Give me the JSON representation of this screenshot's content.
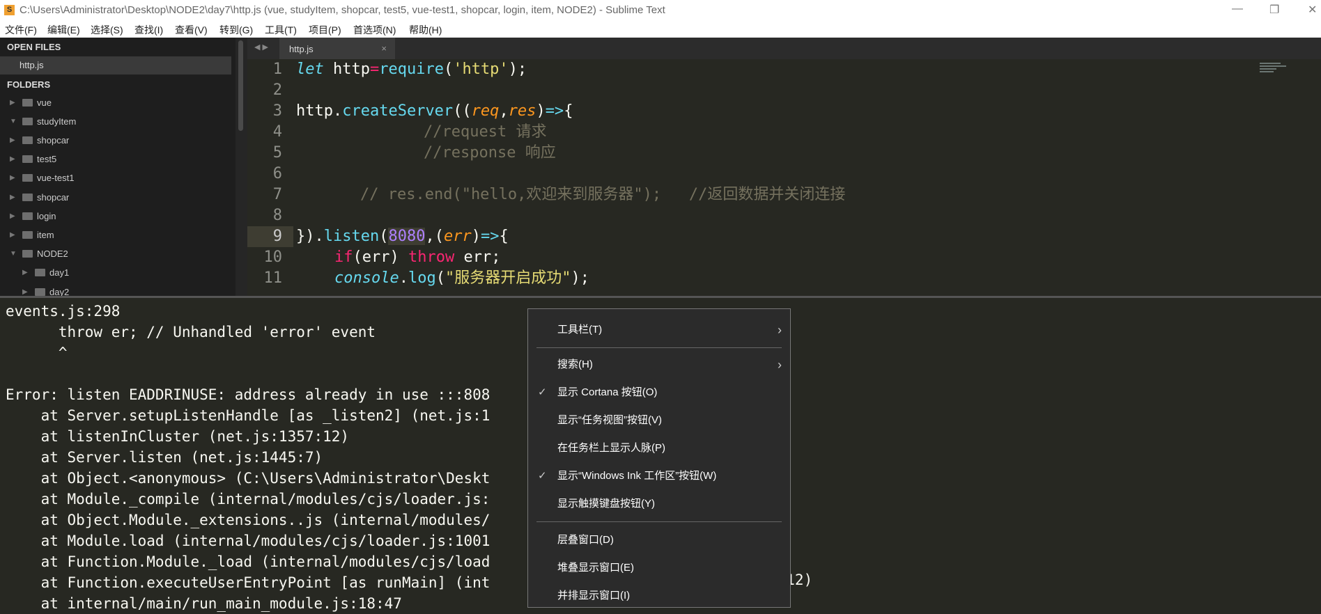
{
  "window": {
    "title": "C:\\Users\\Administrator\\Desktop\\NODE2\\day7\\http.js (vue, studyItem, shopcar, test5, vue-test1, shopcar, login, item, NODE2) - Sublime Text",
    "controls": [
      "minimize",
      "restore",
      "close"
    ]
  },
  "menu": [
    "文件(F)",
    "编辑(E)",
    "选择(S)",
    "查找(I)",
    "查看(V)",
    "转到(G)",
    "工具(T)",
    "项目(P)",
    "首选项(N)",
    "帮助(H)"
  ],
  "sidebar": {
    "open_files_label": "OPEN FILES",
    "open_files": [
      "http.js"
    ],
    "folders_label": "FOLDERS",
    "folders": [
      {
        "name": "vue",
        "expanded": false
      },
      {
        "name": "studyItem",
        "expanded": true
      },
      {
        "name": "shopcar",
        "expanded": false
      },
      {
        "name": "test5",
        "expanded": false
      },
      {
        "name": "vue-test1",
        "expanded": false
      },
      {
        "name": "shopcar",
        "expanded": false
      },
      {
        "name": "login",
        "expanded": false
      },
      {
        "name": "item",
        "expanded": false
      },
      {
        "name": "NODE2",
        "expanded": true
      },
      {
        "name": "day1",
        "expanded": false
      },
      {
        "name": "day2",
        "expanded": false
      }
    ]
  },
  "tab": {
    "label": "http.js",
    "close": "×"
  },
  "editor": {
    "line_numbers": [
      "1",
      "2",
      "3",
      "4",
      "5",
      "6",
      "7",
      "8",
      "9",
      "10",
      "11"
    ],
    "current_line": "9",
    "lines": {
      "l1": [
        "let",
        " http",
        "=",
        "require",
        "(",
        "'http'",
        ");"
      ],
      "l3": [
        "http.",
        "createServer",
        "((",
        "req",
        ",",
        "res",
        ")",
        "=>",
        "{"
      ],
      "l4": "//request 请求",
      "l5": "//response 响应",
      "l7": "// res.end(\"hello,欢迎来到服务器\");   //返回数据并关闭连接",
      "l9": [
        "}).",
        "listen",
        "(",
        "8080",
        ",(",
        "err",
        ")",
        "=>",
        "{"
      ],
      "l10": [
        "if",
        "(err) ",
        "throw",
        " err;"
      ],
      "l11": [
        "console",
        ".",
        "log",
        "(",
        "\"服务器开启成功\"",
        ");"
      ]
    }
  },
  "output": {
    "lines": [
      "events.js:298",
      "      throw er; // Unhandled 'error' event",
      "      ^",
      "",
      "Error: listen EADDRINUSE: address already in use :::808",
      "    at Server.setupListenHandle [as _listen2] (net.js:1",
      "    at listenInCluster (net.js:1357:12)",
      "    at Server.listen (net.js:1445:7)",
      "    at Object.<anonymous> (C:\\Users\\Administrator\\Deskt",
      "    at Module._compile (internal/modules/cjs/loader.js:",
      "    at Object.Module._extensions..js (internal/modules/",
      "    at Module.load (internal/modules/cjs/loader.js:1001",
      "    at Function.Module._load (internal/modules/cjs/load",
      "    at Function.executeUserEntryPoint [as runMain] (int",
      "    at internal/main/run_main_module.js:18:47"
    ],
    "line13_tail": "4:12)"
  },
  "context_menu": {
    "items": [
      {
        "label": "工具栏(T)",
        "submenu": true,
        "checked": false
      },
      {
        "label": "搜索(H)",
        "submenu": true,
        "checked": false
      },
      {
        "label": "显示 Cortana 按钮(O)",
        "submenu": false,
        "checked": true
      },
      {
        "label": "显示“任务视图”按钮(V)",
        "submenu": false,
        "checked": false
      },
      {
        "label": "在任务栏上显示人脉(P)",
        "submenu": false,
        "checked": false
      },
      {
        "label": "显示“Windows Ink 工作区”按钮(W)",
        "submenu": false,
        "checked": true
      },
      {
        "label": "显示触摸键盘按钮(Y)",
        "submenu": false,
        "checked": false
      },
      {
        "label": "层叠窗口(D)",
        "submenu": false,
        "checked": false
      },
      {
        "label": "堆叠显示窗口(E)",
        "submenu": false,
        "checked": false
      },
      {
        "label": "并排显示窗口(I)",
        "submenu": false,
        "checked": false
      }
    ],
    "check_glyph": "✓",
    "submenu_glyph": "›"
  }
}
